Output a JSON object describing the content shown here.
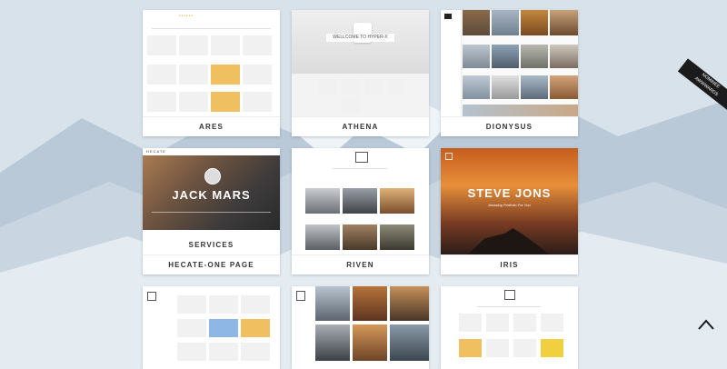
{
  "cards": {
    "ares": {
      "name": "ARES"
    },
    "athena": {
      "name": "ATHENA",
      "hero_text": "WELLCOME TO HYPER-X"
    },
    "dionysus": {
      "name": "DIONYSUS"
    },
    "hecate": {
      "name": "HECATE-ONE PAGE",
      "hero_text": "JACK MARS",
      "section": "SERVICES",
      "brand": "HECATE"
    },
    "riven": {
      "name": "RIVEN"
    },
    "iris": {
      "name": "IRIS",
      "hero_text": "STEVE JONS",
      "sub": "Amazing Portfolio For You"
    }
  },
  "badge": {
    "top": "NOMINEE",
    "bottom": "AWWWARDS"
  },
  "colors": {
    "accent": "#f0a832",
    "dark": "#1b1b1b"
  },
  "icons": [
    "scroll-up-icon"
  ]
}
